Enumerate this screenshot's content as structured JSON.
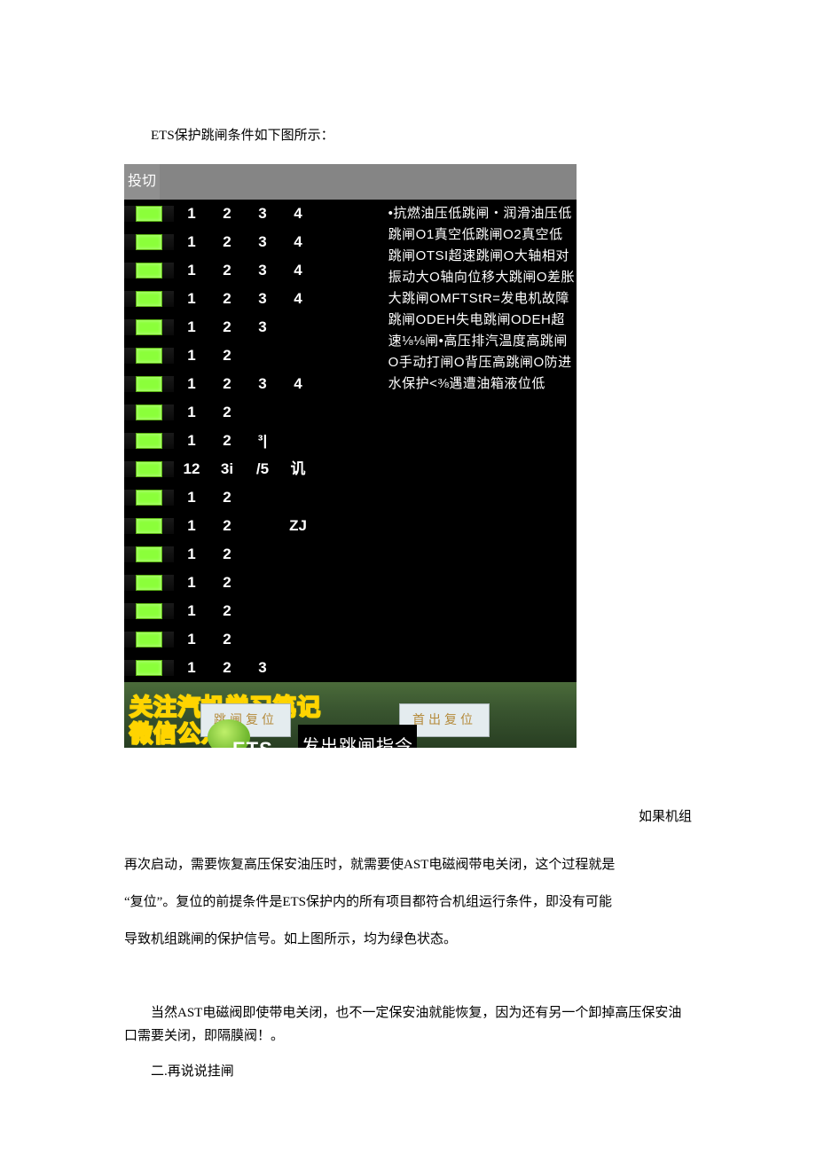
{
  "intro": "ETS保护跳闸条件如下图所示：",
  "screenshot": {
    "chip": "投切",
    "rows": [
      {
        "nums": [
          "1",
          "2",
          "3",
          "4"
        ]
      },
      {
        "nums": [
          "1",
          "2",
          "3",
          "4"
        ]
      },
      {
        "nums": [
          "1",
          "2",
          "3",
          "4"
        ]
      },
      {
        "nums": [
          "1",
          "2",
          "3",
          "4"
        ]
      },
      {
        "nums": [
          "1",
          "2",
          "3",
          ""
        ]
      },
      {
        "nums": [
          "1",
          "2",
          "",
          ""
        ]
      },
      {
        "nums": [
          "1",
          "2",
          "3",
          "4"
        ]
      },
      {
        "nums": [
          "1",
          "2",
          "",
          ""
        ]
      },
      {
        "nums": [
          "1",
          "2",
          "³|",
          ""
        ]
      },
      {
        "nums": [
          "12",
          "3i",
          "/5",
          "讥"
        ]
      },
      {
        "nums": [
          "1",
          "2",
          "",
          ""
        ]
      },
      {
        "nums": [
          "1",
          "2",
          "",
          "ZJ"
        ]
      },
      {
        "nums": [
          "1",
          "2",
          "",
          ""
        ]
      },
      {
        "nums": [
          "1",
          "2",
          "",
          ""
        ]
      },
      {
        "nums": [
          "1",
          "2",
          "",
          ""
        ]
      },
      {
        "nums": [
          "1",
          "2",
          "",
          ""
        ]
      },
      {
        "nums": [
          "1",
          "2",
          "3",
          ""
        ]
      }
    ],
    "right_text": "•抗燃油压低跳闸・润滑油压低跳闸O1真空低跳闸O2真空低跳闸OTSI超速跳闸O大轴相对振动大O轴向位移大跳闸O差胀大跳闸OMFTStR=发电机故障跳闸ODEH失电跳闸ODEH超速⅛⅛闸•高压排汽温度高跳闸O手动打闸O背压高跳闸O防进水保护<⅜遇遭油箱液位低",
    "footer": {
      "wm1": "关注汽机学习笔记",
      "wm2": "微信公众号",
      "btn1": "跳闸复位",
      "btn2": "首出复位",
      "ets": "ETS",
      "cmd": "发出跳闸指令"
    }
  },
  "trail": "如果机组",
  "para1": "再次启动，需要恢复高压保安油压时，就需要使AST电磁阀带电关闭，这个过程就是",
  "para2": "“复位”。复位的前提条件是ETS保护内的所有项目都符合机组运行条件，即没有可能",
  "para3": "导致机组跳闸的保护信号。如上图所示，均为绿色状态。",
  "bold": "当然AST电磁阀即使带电关闭，也不一定保安油就能恢复，因为还有另一个卸掉高压保安油口需要关闭，即隔膜阀！。",
  "sec": "二.再说说挂闸"
}
